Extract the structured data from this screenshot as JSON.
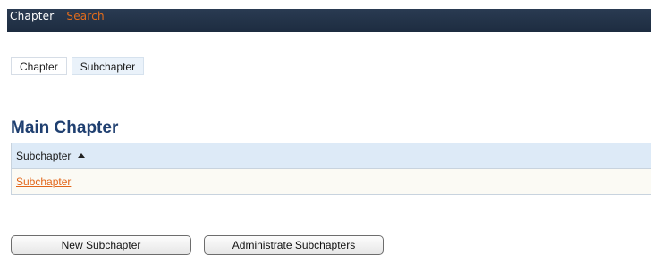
{
  "topnav": {
    "items": [
      {
        "label": "Chapter"
      },
      {
        "label": "Search"
      }
    ]
  },
  "tabs": [
    {
      "label": "Chapter",
      "active": false
    },
    {
      "label": "Subchapter",
      "active": true
    }
  ],
  "main": {
    "title": "Main Chapter",
    "grid": {
      "column_header": "Subchapter",
      "sort_direction": "ascending",
      "rows": [
        {
          "label": "Subchapter"
        }
      ]
    }
  },
  "actions": {
    "new_label": "New Subchapter",
    "admin_label": "Administrate Subchapters"
  },
  "colors": {
    "nav_bg": "#1d2c40",
    "accent": "#e2661a",
    "title": "#1f3f70",
    "grid_header_bg": "#ddeaf7"
  }
}
